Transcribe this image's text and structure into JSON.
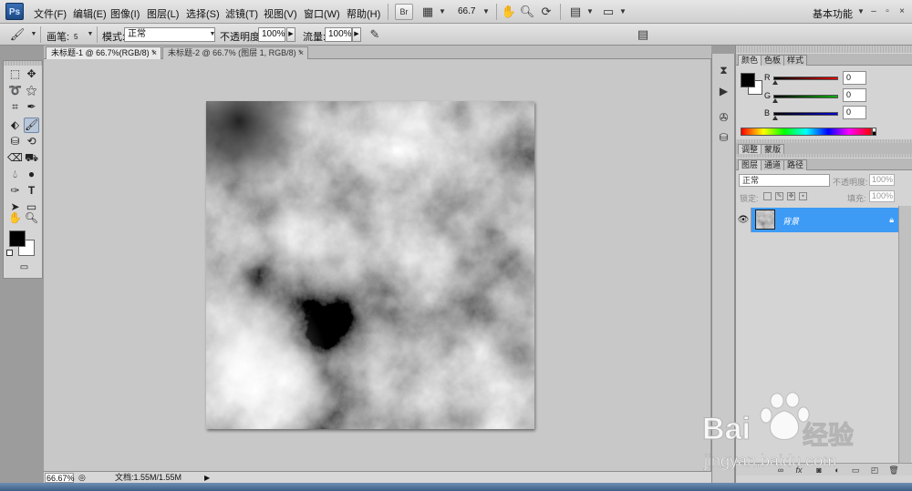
{
  "app": {
    "logo": "Ps",
    "workspace": "基本功能"
  },
  "menu": [
    "文件(F)",
    "编辑(E)",
    "图像(I)",
    "图层(L)",
    "选择(S)",
    "滤镜(T)",
    "视图(V)",
    "窗口(W)",
    "帮助(H)"
  ],
  "menubar": {
    "bridge_label": "Br",
    "zoom": "66.7",
    "win_min": "–",
    "win_restore": "▫",
    "win_close": "×"
  },
  "options": {
    "brush_label": "画笔:",
    "brush_size": "5",
    "mode_label": "模式:",
    "mode_value": "正常",
    "opacity_label": "不透明度:",
    "opacity_value": "100%",
    "flow_label": "流量:",
    "flow_value": "100%"
  },
  "documents": [
    {
      "title": "未标题-1 @ 66.7%(RGB/8) *",
      "close": "×"
    },
    {
      "title": "未标题-2 @ 66.7% (图层 1, RGB/8) *",
      "close": "×"
    }
  ],
  "status": {
    "zoom": "66.67%",
    "doc_label": "文档:1.55M/1.55M",
    "arrow": "▶"
  },
  "color_panel": {
    "tabs": [
      "颜色",
      "色板",
      "样式"
    ],
    "r_label": "R",
    "g_label": "G",
    "b_label": "B",
    "r_value": "0",
    "g_value": "0",
    "b_value": "0",
    "channel_colors": {
      "r": "#e00000",
      "g": "#00b000",
      "b": "#0000d0"
    }
  },
  "adjust_panel": {
    "tabs": [
      "调整",
      "蒙版"
    ]
  },
  "layers_panel": {
    "tabs": [
      "图层",
      "通道",
      "路径"
    ],
    "blend_mode": "正常",
    "opacity_label": "不透明度:",
    "opacity_value": "100%",
    "lock_label": "锁定:",
    "fill_label": "填充:",
    "fill_value": "100%",
    "layers": [
      {
        "name": "背景",
        "selected": true,
        "visible": true,
        "locked": true
      }
    ],
    "footer_icons": [
      "link-icon",
      "fx-icon",
      "mask-icon",
      "adjustment-icon",
      "group-icon",
      "new-layer-icon",
      "trash-icon"
    ]
  },
  "watermark": {
    "brand": "Bai",
    "brand_suffix": "经验",
    "url": "jingyan.baidu.com"
  },
  "colors": {
    "selection_blue": "#3d9bf5",
    "foreground": "#000000",
    "background": "#ffffff"
  }
}
